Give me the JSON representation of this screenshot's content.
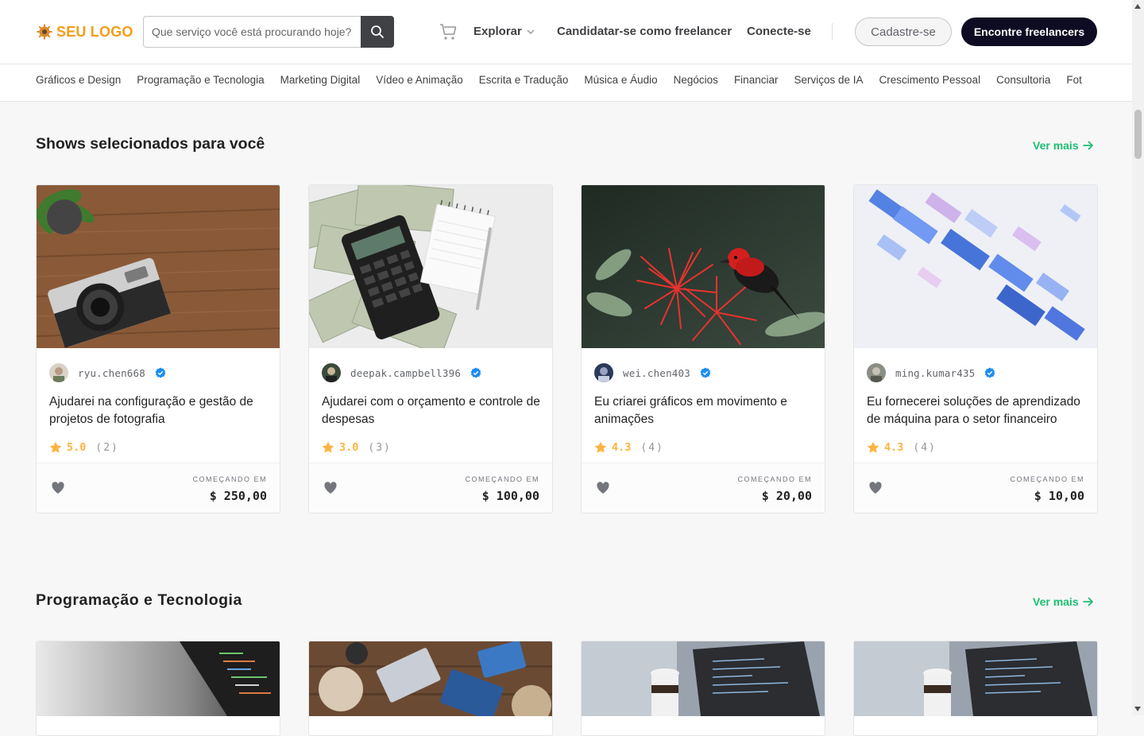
{
  "header": {
    "logo_text": "SEU LOGO",
    "search_placeholder": "Que serviço você está procurando hoje?",
    "nav_explore": "Explorar",
    "nav_freelancer": "Candidatar-se como freelancer",
    "nav_login": "Conecte-se",
    "signup_label": "Cadastre-se",
    "find_label": "Encontre freelancers"
  },
  "categories": [
    "Gráficos e Design",
    "Programação e Tecnologia",
    "Marketing Digital",
    "Vídeo e Animação",
    "Escrita e Tradução",
    "Música e Áudio",
    "Negócios",
    "Financiar",
    "Serviços de IA",
    "Crescimento Pessoal",
    "Consultoria",
    "Fot"
  ],
  "sections": [
    {
      "title": "Shows selecionados para você",
      "see_more": "Ver mais",
      "cards": [
        {
          "seller": "ryu.chen668",
          "title": "Ajudarei na configuração e gestão de projetos de fotografia",
          "rating": "5.0",
          "count": "(2)",
          "price_label": "COMEÇANDO EM",
          "price": "$ 250,00",
          "image": "camera-on-wood"
        },
        {
          "seller": "deepak.campbell396",
          "title": "Ajudarei com o orçamento e controle de despesas",
          "rating": "3.0",
          "count": "(3)",
          "price_label": "COMEÇANDO EM",
          "price": "$ 100,00",
          "image": "calculator-and-money"
        },
        {
          "seller": "wei.chen403",
          "title": "Eu criarei gráficos em movimento e animações",
          "rating": "4.3",
          "count": "(4)",
          "price_label": "COMEÇANDO EM",
          "price": "$ 20,00",
          "image": "red-bird-on-flower"
        },
        {
          "seller": "ming.kumar435",
          "title": "Eu fornecerei soluções de aprendizado de máquina para o setor financeiro",
          "rating": "4.3",
          "count": "(4)",
          "price_label": "COMEÇANDO EM",
          "price": "$ 10,00",
          "image": "abstract-blue-cubes"
        }
      ]
    },
    {
      "title": "Programação e Tecnologia",
      "see_more": "Ver mais"
    }
  ],
  "colors": {
    "accent": "#1dbf73",
    "star": "#ffb33e",
    "dark": "#0e0c22",
    "logo": "#f39c1a"
  }
}
